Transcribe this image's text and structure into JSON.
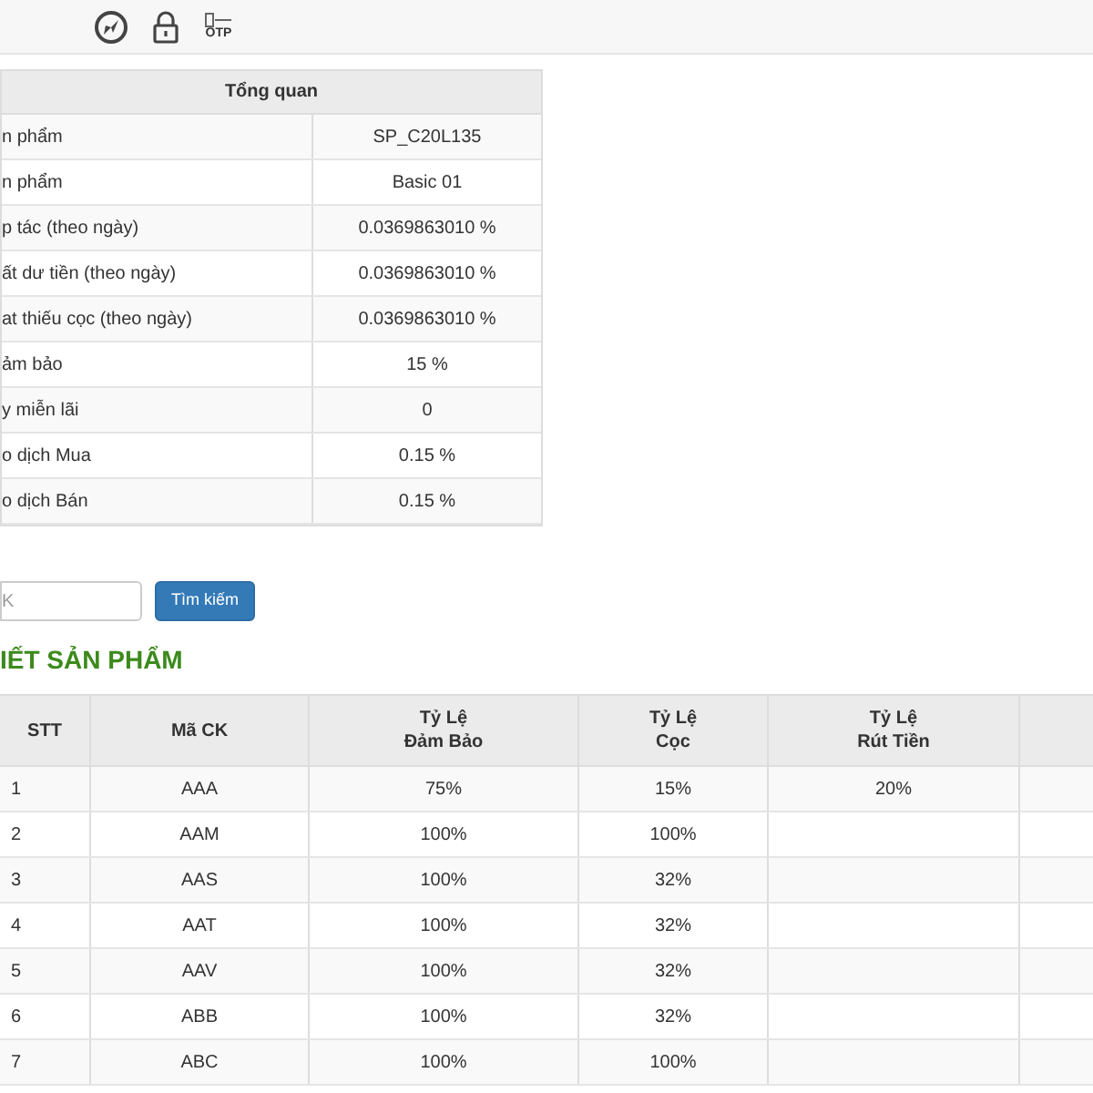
{
  "toolbar": {
    "otp_label": "OTP"
  },
  "overview": {
    "title": "Tổng quan",
    "rows": [
      {
        "label": "n phẩm",
        "value": "SP_C20L135"
      },
      {
        "label": "n phẩm",
        "value": "Basic 01"
      },
      {
        "label": "p tác (theo ngày)",
        "value": "0.0369863010 %"
      },
      {
        "label": "ất dư tiền (theo ngày)",
        "value": "0.0369863010 %"
      },
      {
        "label": "at thiếu cọc (theo ngày)",
        "value": "0.0369863010 %"
      },
      {
        "label": "ảm bảo",
        "value": "15 %"
      },
      {
        "label": "y miễn lãi",
        "value": "0"
      },
      {
        "label": "o dịch Mua",
        "value": "0.15 %"
      },
      {
        "label": "o dịch Bán",
        "value": "0.15 %"
      }
    ]
  },
  "search": {
    "placeholder": "K",
    "button": "Tìm kiếm"
  },
  "section_title": "IẾT SẢN PHẨM",
  "table": {
    "columns": [
      "STT",
      "Mã CK",
      "Tỷ Lệ\nĐảm Bảo",
      "Tỷ Lệ\nCọc",
      "Tỷ Lệ\nRút Tiền"
    ],
    "rows": [
      [
        "1",
        "AAA",
        "75%",
        "15%",
        "20%"
      ],
      [
        "2",
        "AAM",
        "100%",
        "100%",
        ""
      ],
      [
        "3",
        "AAS",
        "100%",
        "32%",
        ""
      ],
      [
        "4",
        "AAT",
        "100%",
        "32%",
        ""
      ],
      [
        "5",
        "AAV",
        "100%",
        "32%",
        ""
      ],
      [
        "6",
        "ABB",
        "100%",
        "32%",
        ""
      ],
      [
        "7",
        "ABC",
        "100%",
        "100%",
        ""
      ]
    ]
  }
}
